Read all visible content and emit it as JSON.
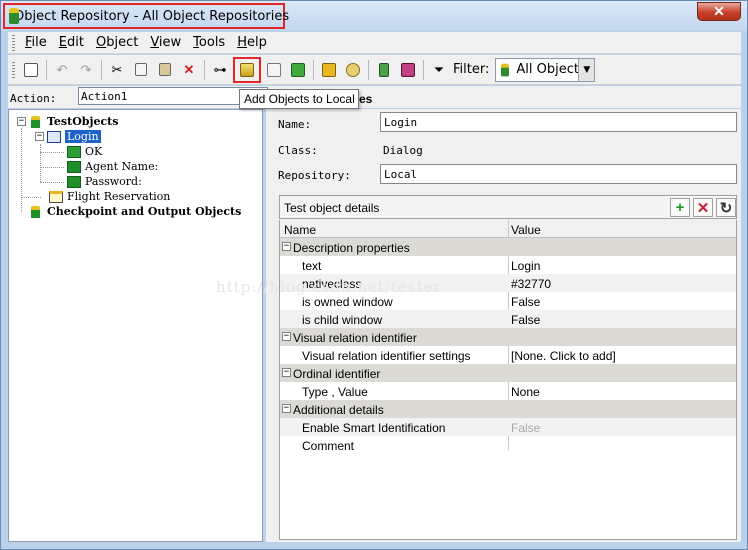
{
  "window": {
    "title": "Object Repository - All Object Repositories",
    "close_symbol": "✕"
  },
  "menu": [
    {
      "label_u": "F",
      "label_rest": "ile"
    },
    {
      "label_u": "E",
      "label_rest": "dit"
    },
    {
      "label_u": "O",
      "label_rest": "bject"
    },
    {
      "label_u": "V",
      "label_rest": "iew"
    },
    {
      "label_u": "T",
      "label_rest": "ools"
    },
    {
      "label_u": "H",
      "label_rest": "elp"
    }
  ],
  "toolbar": {
    "filter_label": "Filter:",
    "filter_value": "All Object",
    "tooltip": "Add Objects to Local",
    "tooltip_tail": "es"
  },
  "action": {
    "label": "Action:",
    "value": "Action1"
  },
  "tree": {
    "root": "TestObjects",
    "dialog": "Login",
    "ok": "OK",
    "agent": "Agent Name:",
    "password": "Password:",
    "flight": "Flight Reservation",
    "checkpoints": "Checkpoint and Output Objects"
  },
  "properties": {
    "name_label": "Name:",
    "name_value": "Login",
    "class_label": "Class:",
    "class_value": "Dialog",
    "repo_label": "Repository:",
    "repo_value": "Local"
  },
  "details": {
    "title": "Test object details",
    "col_name": "Name",
    "col_value": "Value",
    "rows": [
      {
        "key": "Description properties",
        "value": ""
      },
      {
        "key": "text",
        "value": "Login"
      },
      {
        "key": "nativeclass",
        "value": "#32770"
      },
      {
        "key": "is owned window",
        "value": "False"
      },
      {
        "key": "is child window",
        "value": "False"
      },
      {
        "key": "Visual relation identifier",
        "value": ""
      },
      {
        "key": "Visual relation identifier settings",
        "value": "[None. Click to add]"
      },
      {
        "key": "Ordinal identifier",
        "value": ""
      },
      {
        "key": "Type , Value",
        "value": "None"
      },
      {
        "key": "Additional details",
        "value": ""
      },
      {
        "key": "Enable Smart Identification",
        "value": "False"
      },
      {
        "key": "Comment",
        "value": ""
      }
    ]
  },
  "watermark": "http://blog.csdn.net/tester",
  "colors": {
    "title_highlight": "#e0262c",
    "selection": "#1c62c8"
  }
}
